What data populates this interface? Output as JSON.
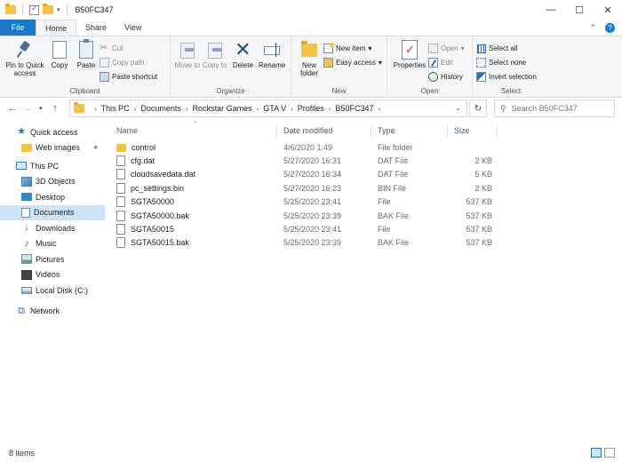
{
  "window": {
    "title": "B50FC347",
    "minimize": "—",
    "maximize": "☐",
    "close": "✕"
  },
  "ribbon_tabs": {
    "file": "File",
    "home": "Home",
    "share": "Share",
    "view": "View",
    "collapse": "⌃",
    "help": "?"
  },
  "clipboard": {
    "pin_quick_access": "Pin to Quick access",
    "copy": "Copy",
    "paste": "Paste",
    "cut": "Cut",
    "copy_path": "Copy path",
    "paste_shortcut": "Paste shortcut",
    "label": "Clipboard"
  },
  "organize": {
    "move_to": "Move to",
    "copy_to": "Copy to",
    "delete": "Delete",
    "rename": "Rename",
    "label": "Organize"
  },
  "new": {
    "new_folder": "New folder",
    "new_item": "New item",
    "easy_access": "Easy access",
    "label": "New"
  },
  "open": {
    "properties": "Properties",
    "open": "Open",
    "edit": "Edit",
    "history": "History",
    "label": "Open"
  },
  "select": {
    "select_all": "Select all",
    "select_none": "Select none",
    "invert_selection": "Invert selection",
    "label": "Select"
  },
  "address": {
    "crumbs": [
      "This PC",
      "Documents",
      "Rockstar Games",
      "GTA V",
      "Profiles",
      "B50FC347"
    ],
    "search_placeholder": "Search B50FC347"
  },
  "nav": {
    "quick_access": "Quick access",
    "web_images": "Web images",
    "this_pc": "This PC",
    "objects_3d": "3D Objects",
    "desktop": "Desktop",
    "documents": "Documents",
    "downloads": "Downloads",
    "music": "Music",
    "pictures": "Pictures",
    "videos": "Videos",
    "local_disk": "Local Disk (C:)",
    "network": "Network"
  },
  "columns": {
    "name": "Name",
    "date_modified": "Date modified",
    "type": "Type",
    "size": "Size"
  },
  "files": [
    {
      "name": "control",
      "date": "4/6/2020 1:49",
      "type": "File folder",
      "size": ""
    },
    {
      "name": "cfg.dat",
      "date": "5/27/2020 16:31",
      "type": "DAT File",
      "size": "2 KB"
    },
    {
      "name": "cloudsavedata.dat",
      "date": "5/27/2020 16:34",
      "type": "DAT File",
      "size": "5 KB"
    },
    {
      "name": "pc_settings.bin",
      "date": "5/27/2020 16:23",
      "type": "BIN File",
      "size": "2 KB"
    },
    {
      "name": "SGTA50000",
      "date": "5/25/2020 23:41",
      "type": "File",
      "size": "537 KB"
    },
    {
      "name": "SGTA50000.bak",
      "date": "5/25/2020 23:39",
      "type": "BAK File",
      "size": "537 KB"
    },
    {
      "name": "SGTA50015",
      "date": "5/25/2020 23:41",
      "type": "File",
      "size": "537 KB"
    },
    {
      "name": "SGTA50015.bak",
      "date": "5/25/2020 23:39",
      "type": "BAK File",
      "size": "537 KB"
    }
  ],
  "status": {
    "item_count": "8 items"
  }
}
